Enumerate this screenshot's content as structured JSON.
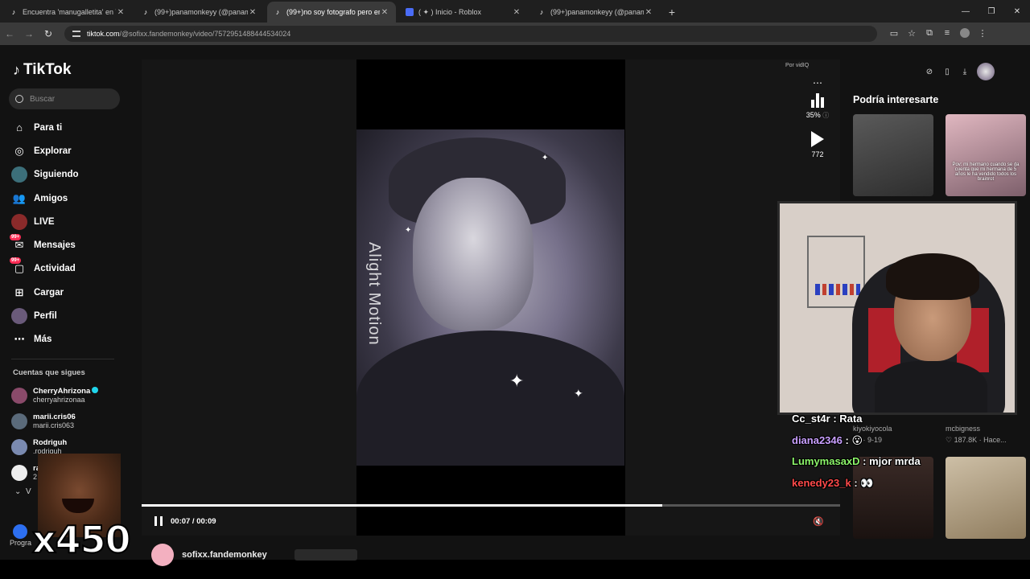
{
  "browser": {
    "tabs": [
      {
        "title": "Encuentra 'manugalletita' en Ti",
        "active": false,
        "icon": "tiktok-icon"
      },
      {
        "title": "(99+)panamonkeyy (@panamo",
        "active": false,
        "icon": "tiktok-icon"
      },
      {
        "title": "(99+)no soy fotografo pero en",
        "active": true,
        "icon": "tiktok-icon"
      },
      {
        "title": "( ✦ ) Inicio - Roblox",
        "active": false,
        "icon": "roblox-icon"
      },
      {
        "title": "(99+)panamonkeyy (@panamo",
        "active": false,
        "icon": "tiktok-icon"
      }
    ],
    "url_host": "tiktok.com",
    "url_path": "/@sofixx.fandemonkey/video/7572951488444534024"
  },
  "sidebar": {
    "logo": "TikTok",
    "search_placeholder": "Buscar",
    "menu": [
      {
        "label": "Para ti",
        "icon": "home-icon"
      },
      {
        "label": "Explorar",
        "icon": "compass-icon"
      },
      {
        "label": "Siguiendo",
        "icon": "following-icon"
      },
      {
        "label": "Amigos",
        "icon": "friends-icon"
      },
      {
        "label": "LIVE",
        "icon": "live-icon"
      },
      {
        "label": "Mensajes",
        "icon": "messages-icon",
        "badge": "99+"
      },
      {
        "label": "Actividad",
        "icon": "activity-icon",
        "badge": "99+"
      },
      {
        "label": "Cargar",
        "icon": "upload-icon"
      },
      {
        "label": "Perfil",
        "icon": "profile-icon"
      },
      {
        "label": "Más",
        "icon": "more-icon"
      }
    ],
    "following_title": "Cuentas que sigues",
    "following": [
      {
        "name": "CherryAhrizona",
        "handle": "cherryahrizonaa",
        "verified": true
      },
      {
        "name": "marii.cris06",
        "handle": "marii.cris063",
        "verified": false
      },
      {
        "name": "Rodriguh",
        "handle": "rodriguh",
        "verified": false
      },
      {
        "name": "ra",
        "handle": "2",
        "verified": false
      }
    ],
    "see_more": "V",
    "footer_text": "Progra"
  },
  "overlay": {
    "meme_multiplier": "x450"
  },
  "player": {
    "vidiq_label": "Por vidIQ",
    "vidiq_score": "35%",
    "play_count": "772",
    "video_watermark": "Alight Motion",
    "time": "00:07 / 00:09",
    "progress_fraction": 0.745,
    "author": "sofixx.fandemonkey"
  },
  "right": {
    "title": "Podría interesarte",
    "thumb2_caption": "Pov: mi hermano cuando se da cuenta que mi hermana de 5 años le ha vendido todos los brainrot",
    "meta": [
      {
        "author": "kiyokiyocola",
        "stat": "51",
        "date": "9-19"
      },
      {
        "author": "mcbigness",
        "stat": "♡ 187.8K",
        "date": "Hace..."
      }
    ]
  },
  "chat": [
    {
      "user": "Cc_st4r",
      "msg": ": Rata",
      "color": "#ffffff"
    },
    {
      "user": "diana2346",
      "msg": ": 😮",
      "color": "#c9a0ff"
    },
    {
      "user": "LumymasaxD",
      "msg": ": mjor mrda",
      "color": "#8cf56a"
    },
    {
      "user": "kenedy23_k",
      "msg": ": 👀",
      "color": "#ff4a4a"
    }
  ]
}
